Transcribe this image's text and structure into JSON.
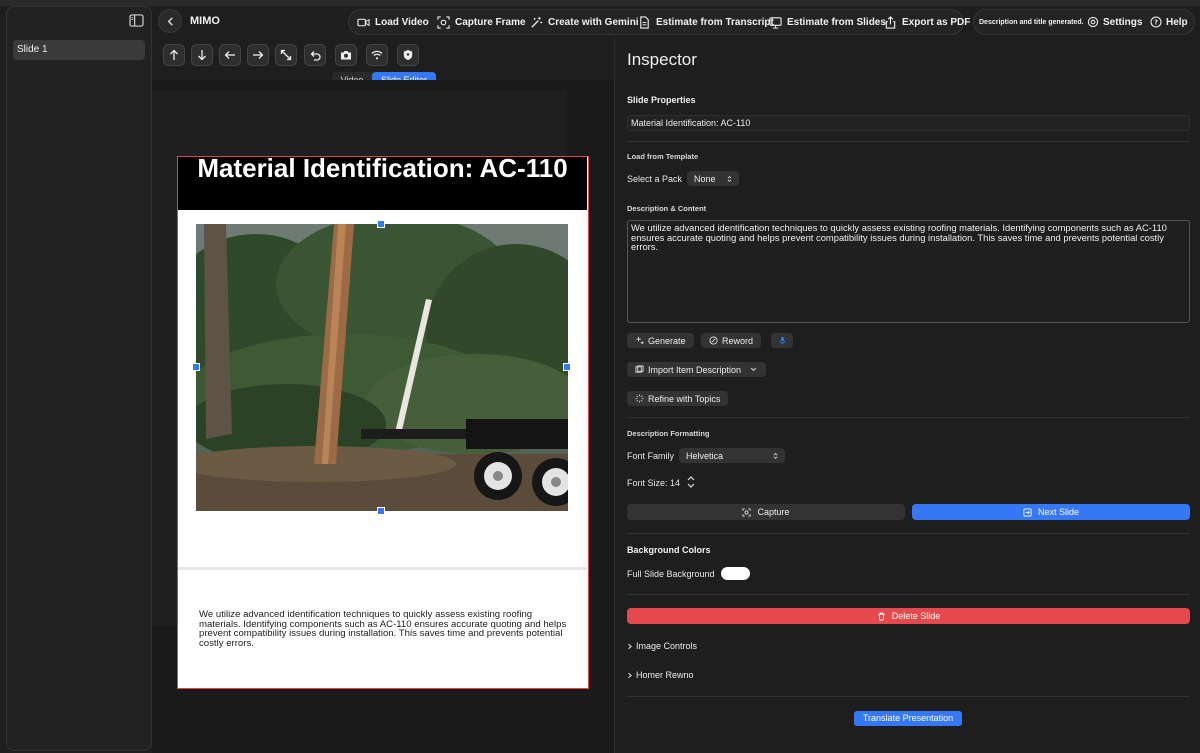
{
  "app": {
    "title": "MIMO"
  },
  "toolbar": {
    "load_video": "Load Video",
    "capture_frame": "Capture Frame",
    "create_gemini": "Create with Gemini",
    "estimate_transcript": "Estimate from Transcript",
    "estimate_slides": "Estimate from Slides",
    "export_pdf": "Export as PDF",
    "status": "Description and title generated.",
    "settings": "Settings",
    "help": "Help"
  },
  "sidebar": {
    "items": [
      {
        "label": "Slide 1"
      }
    ]
  },
  "view_toggle": {
    "video": "Video",
    "slide_editor": "Slide Editor",
    "selected": "Slide Editor"
  },
  "editor_tools": [
    "arrow-up-icon",
    "arrow-down-icon",
    "arrow-left-icon",
    "arrow-right-icon",
    "expand-icon",
    "undo-icon",
    "camera-icon",
    "wifi-icon",
    "shield-icon"
  ],
  "slide": {
    "title": "Material Identification: AC-110",
    "description": "We utilize advanced identification techniques to quickly assess existing roofing materials. Identifying components such as AC-110 ensures accurate quoting and helps prevent compatibility issues during installation. This saves time and prevents potential costly errors."
  },
  "inspector": {
    "title": "Inspector",
    "slide_properties": "Slide Properties",
    "slide_title_value": "Material Identification: AC-110",
    "load_from_template": "Load from Template",
    "select_pack_label": "Select a Pack",
    "select_pack_value": "None",
    "description_content": "Description & Content",
    "description_value": "We utilize advanced identification techniques to quickly assess existing roofing materials. Identifying components such as AC-110 ensures accurate quoting and helps prevent compatibility issues during installation. This saves time and prevents potential costly errors.",
    "generate": "Generate",
    "reword": "Reword",
    "import_item_description": "Import Item Description",
    "refine_with_topics": "Refine with Topics",
    "description_formatting": "Description Formatting",
    "font_family_label": "Font Family",
    "font_family_value": "Helvetica",
    "font_size_label": "Font Size: 14",
    "capture": "Capture",
    "next_slide": "Next Slide",
    "background_colors": "Background Colors",
    "full_slide_background": "Full Slide Background",
    "full_slide_background_color": "#ffffff",
    "delete_slide": "Delete Slide",
    "image_controls": "Image Controls",
    "homer_rewno": "Homer Rewno",
    "translate_presentation": "Translate Presentation"
  },
  "colors": {
    "accent": "#3478f6",
    "danger": "#e5484d",
    "selection_border": "#e0463f"
  }
}
